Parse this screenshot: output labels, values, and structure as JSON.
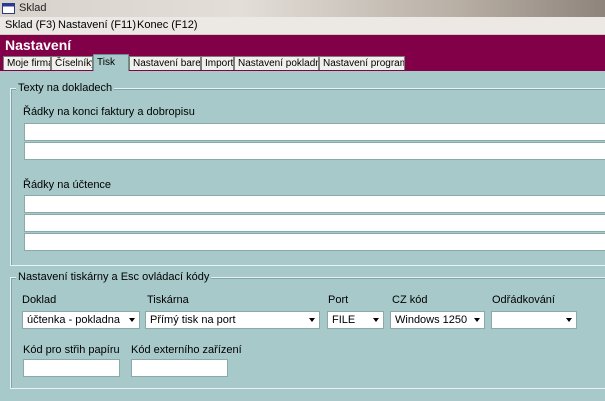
{
  "window": {
    "title": "Sklad"
  },
  "menu": {
    "items": [
      "Sklad (F3)",
      "Nastavení (F11)",
      "Konec (F12)"
    ]
  },
  "page": {
    "title": "Nastavení"
  },
  "tabs": [
    "Moje firma",
    "Číselníky",
    "Tisk",
    "Nastavení barev",
    "Import",
    "Nastavení pokladny",
    "Nastavení programu"
  ],
  "texts_group": {
    "label": "Texty na dokladech",
    "invoice_label": "Řádky na konci faktury a dobropisu",
    "receipt_label": "Řádky na účtence"
  },
  "printer_group": {
    "label": "Nastavení tiskárny a Esc ovládací kódy",
    "doklad": {
      "label": "Doklad",
      "value": "účtenka - pokladna"
    },
    "tiskarna": {
      "label": "Tiskárna",
      "value": "Přímý tisk na port"
    },
    "port": {
      "label": "Port",
      "value": "FILE"
    },
    "cz_kod": {
      "label": "CZ kód",
      "value": "Windows 1250"
    },
    "odradkovani": {
      "label": "Odřádkování",
      "value": ""
    },
    "strih_label": "Kód pro střih papíru",
    "externi_label": "Kód externího zařízení"
  }
}
